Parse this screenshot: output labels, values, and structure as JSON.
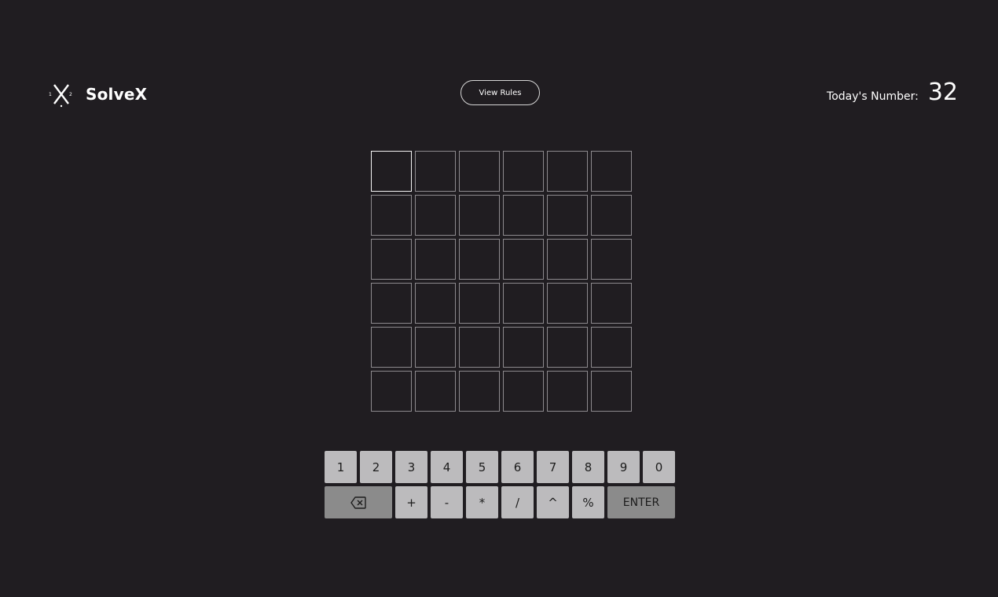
{
  "header": {
    "brand": {
      "name": "SolveX",
      "logo_superscripts": [
        "1",
        "2"
      ]
    },
    "rules_button_label": "View Rules",
    "today": {
      "label": "Today's Number:",
      "value": "32"
    }
  },
  "grid": {
    "rows": 6,
    "cols": 6,
    "active_cell": [
      0,
      0
    ]
  },
  "keyboard": {
    "row1": [
      "1",
      "2",
      "3",
      "4",
      "5",
      "6",
      "7",
      "8",
      "9",
      "0"
    ],
    "row2": [
      "+",
      "-",
      "*",
      "/",
      "^",
      "%"
    ],
    "backspace_icon": "backspace-icon",
    "enter_label": "ENTER"
  },
  "colors": {
    "background": "#201d21",
    "key": "#bcbbbd",
    "key_wide": "#8b8b8b",
    "cell_border": "#8d8a8e",
    "active_cell_border": "#f4f4f4"
  }
}
